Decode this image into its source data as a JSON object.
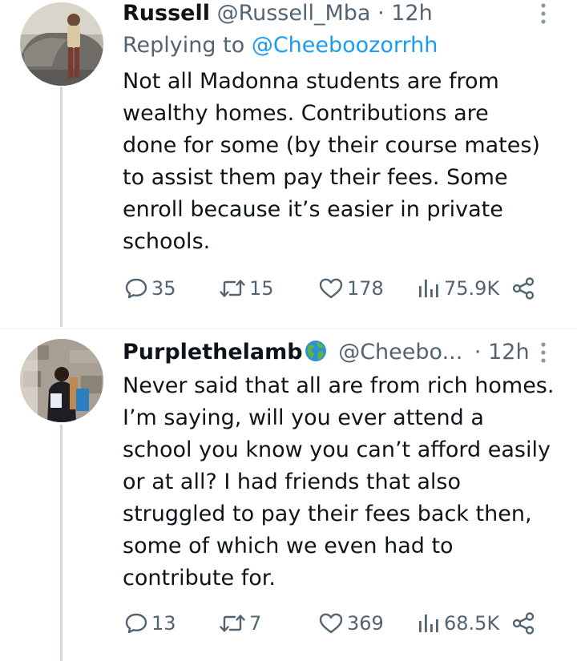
{
  "tweets": [
    {
      "name": "Russell",
      "handle": "@Russell_Mba",
      "time": "· 12h",
      "replying_prefix": "Replying to ",
      "replying_to": "@Cheeboozorrhh",
      "lines": [
        "Not all Madonna students are from",
        "wealthy homes. Contributions are",
        "done for some (by their course mates)",
        "to assist them pay their fees. Some",
        "enroll because it’s easier in private",
        "schools."
      ],
      "replies": "35",
      "retweets": "15",
      "likes": "178",
      "views": "75.9K"
    },
    {
      "name": "Purplethelamb",
      "handle": "@Cheebo...",
      "time": "· 12h",
      "lines": [
        "Never said that all are from rich homes.",
        "I’m saying, will you ever attend a",
        "school you know you can’t afford easily",
        "or at all? I had friends that also",
        "struggled to pay their fees back then,",
        "some of which we even had to",
        "contribute for."
      ],
      "replies": "13",
      "retweets": "7",
      "likes": "369",
      "views": "68.5K"
    }
  ],
  "icons": {
    "more": "more-vertical-icon",
    "reply": "reply-icon",
    "retweet": "retweet-icon",
    "like": "heart-icon",
    "views": "views-icon",
    "share": "share-icon",
    "globe": "globe-emoji-icon"
  },
  "colors": {
    "text": "#0f1419",
    "secondary": "#536471",
    "link": "#1d9bf0",
    "thread_line": "#cfd9de"
  }
}
